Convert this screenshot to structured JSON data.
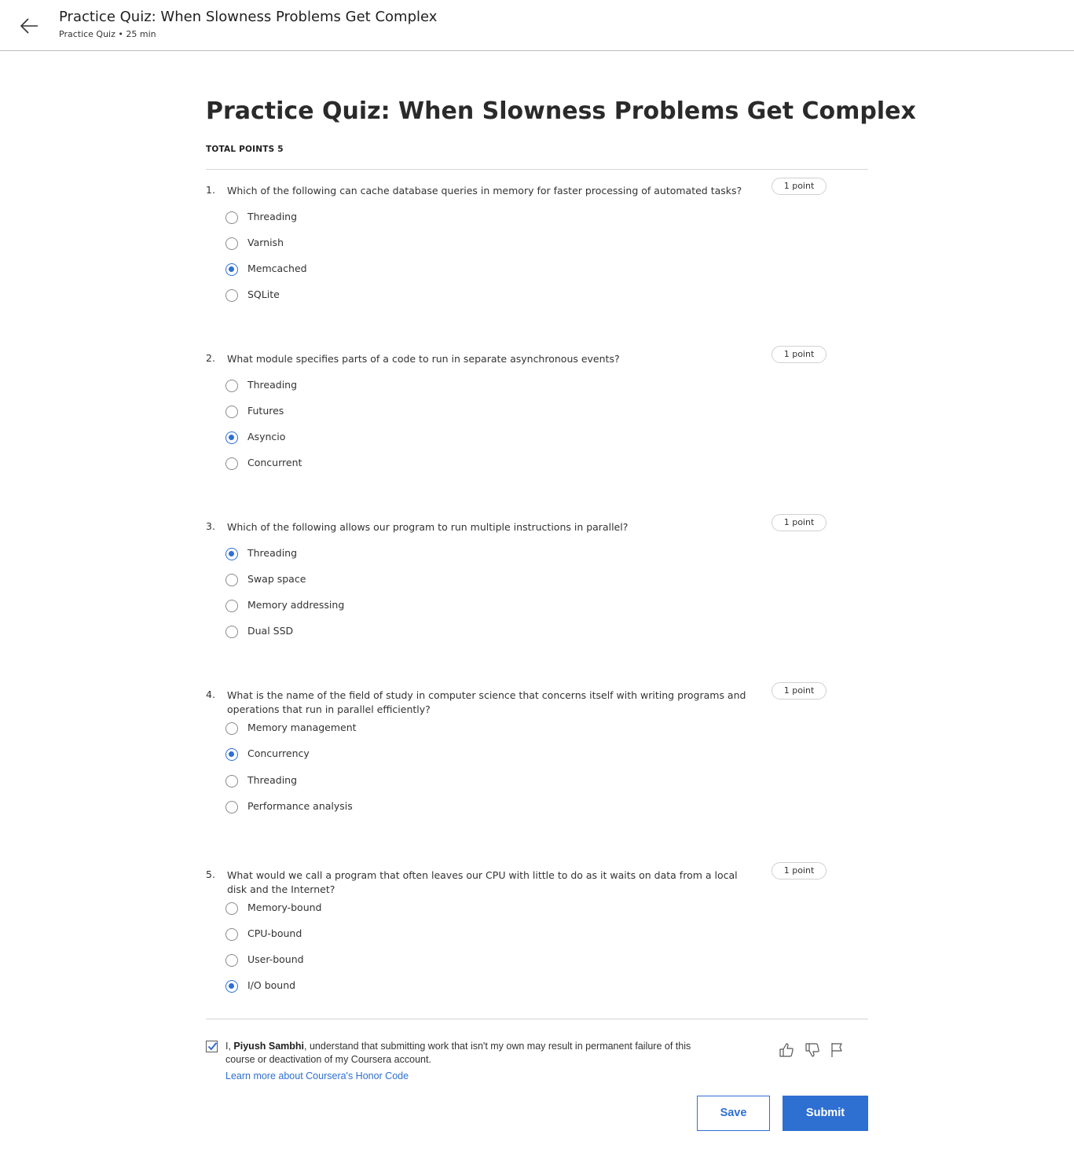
{
  "header": {
    "title": "Practice Quiz: When Slowness Problems Get Complex",
    "subtitle": "Practice Quiz • 25 min"
  },
  "main": {
    "title": "Practice Quiz: When Slowness Problems Get Complex",
    "total_points": "TOTAL POINTS 5"
  },
  "questions": [
    {
      "number": "1.",
      "text": "Which of the following can cache database queries in memory for faster processing of automated tasks?",
      "points": "1 point",
      "options": [
        "Threading",
        "Varnish",
        "Memcached",
        "SQLite"
      ],
      "selected": 2
    },
    {
      "number": "2.",
      "text": "What module specifies parts of a code to run in separate asynchronous events?",
      "points": "1 point",
      "options": [
        "Threading",
        "Futures",
        "Asyncio",
        "Concurrent"
      ],
      "selected": 2
    },
    {
      "number": "3.",
      "text": "Which of the following allows our program to run multiple instructions in parallel?",
      "points": "1 point",
      "options": [
        "Threading",
        "Swap space",
        "Memory addressing",
        "Dual SSD"
      ],
      "selected": 0
    },
    {
      "number": "4.",
      "text": "What is the name of the field of study in computer science that concerns itself with writing programs and operations that run in parallel efficiently?",
      "points": "1 point",
      "options": [
        "Memory management",
        "Concurrency",
        "Threading",
        "Performance analysis"
      ],
      "selected": 1
    },
    {
      "number": "5.",
      "text": "What would we call a program that often leaves our CPU with little to do as it waits on data from a local disk and the Internet?",
      "points": "1 point",
      "options": [
        "Memory-bound",
        "CPU-bound",
        "User-bound",
        "I/O bound"
      ],
      "selected": 3
    }
  ],
  "honor": {
    "prefix": "I, ",
    "name": "Piyush Sambhi",
    "suffix": ", understand that submitting work that isn't my own may result in permanent failure of this course or deactivation of my Coursera account.",
    "checked": true,
    "link": "Learn more about Coursera's Honor Code"
  },
  "feedback": {
    "like_icon": "thumbs-up-icon",
    "dislike_icon": "thumbs-down-icon",
    "flag_icon": "flag-icon"
  },
  "actions": {
    "save_label": "Save",
    "submit_label": "Submit"
  },
  "colors": {
    "accent": "#2e6fd2",
    "divider": "#d6d6d6"
  }
}
